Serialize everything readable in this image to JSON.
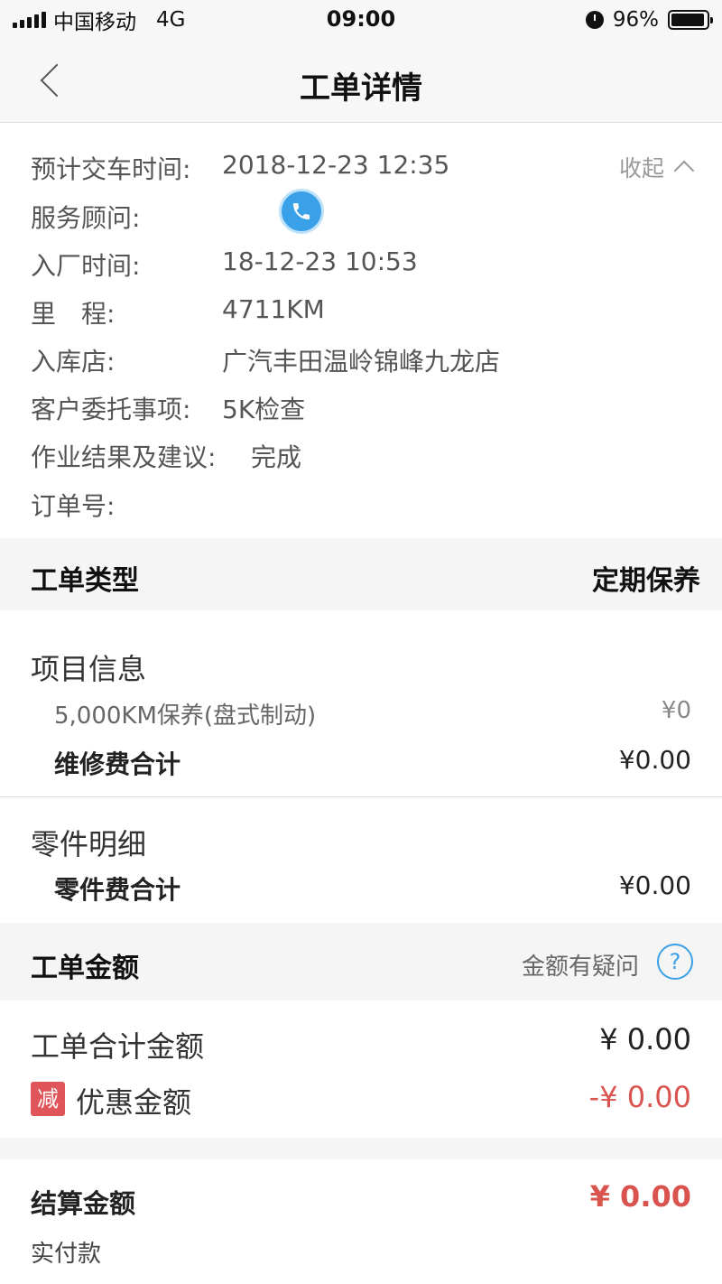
{
  "status_bar": {
    "carrier": "中国移动",
    "network": "4G",
    "time": "09:00",
    "battery": "96%",
    "battery_level": 0.96
  },
  "nav": {
    "title": "工单详情"
  },
  "info": {
    "collapse_label": "收起",
    "rows": [
      {
        "label": "预计交车时间:",
        "value": "2018-12-23 12:35"
      },
      {
        "label": "服务顾问:",
        "value": ""
      },
      {
        "label": "入厂时间:",
        "value": "18-12-23 10:53"
      },
      {
        "label": "里　程:",
        "value": "4711KM"
      },
      {
        "label": "入库店:",
        "value": "广汽丰田温岭锦峰九龙店"
      },
      {
        "label": "客户委托事项:",
        "value": "5K检查"
      },
      {
        "label": "作业结果及建议:",
        "value": "完成"
      },
      {
        "label": "订单号:",
        "value": ""
      }
    ]
  },
  "order_type": {
    "label": "工单类型",
    "value": "定期保养"
  },
  "project_info": {
    "title": "项目信息",
    "item_name": "5,000KM保养(盘式制动)",
    "item_price": "¥0",
    "subtotal_label": "维修费合计",
    "subtotal_value": "¥0.00"
  },
  "parts": {
    "title": "零件明细",
    "subtotal_label": "零件费合计",
    "subtotal_value": "¥0.00"
  },
  "order_amount": {
    "label": "工单金额",
    "question_label": "金额有疑问",
    "help_glyph": "?",
    "total_label": "工单合计金额",
    "total_value": "¥ 0.00",
    "discount_badge": "减",
    "discount_label": "优惠金额",
    "discount_value": "-¥ 0.00"
  },
  "settlement": {
    "label": "结算金额",
    "value": "¥ 0.00",
    "sub_label": "实付款"
  },
  "colors": {
    "accent_blue": "#3aa0e8",
    "price_red": "#d9534f",
    "badge_red": "#e0555a"
  }
}
